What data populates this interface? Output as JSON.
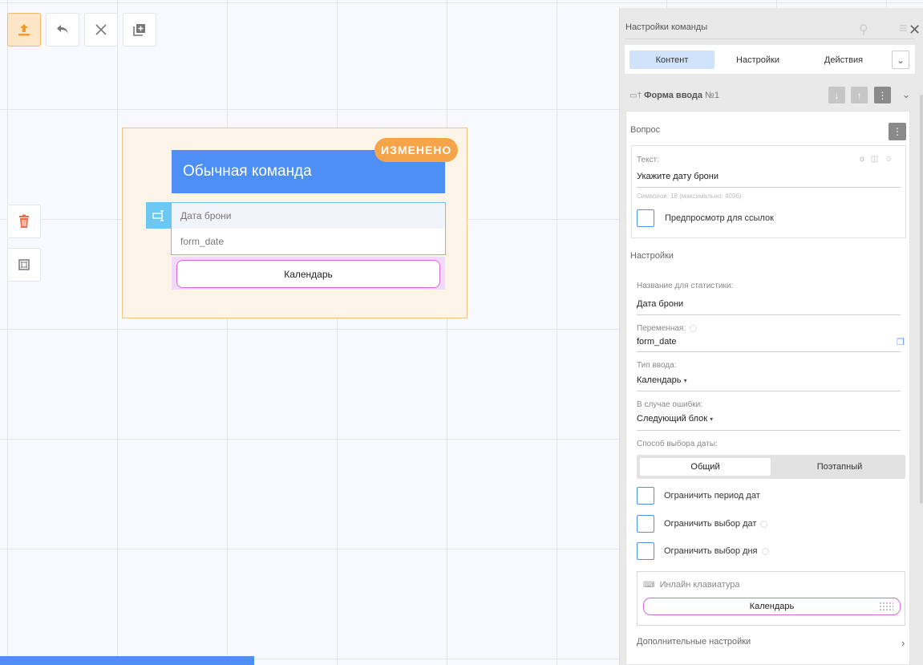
{
  "canvas": {
    "toolbar": {
      "publish_icon": "upload-icon",
      "undo_icon": "undo-icon",
      "close_icon": "close-icon",
      "add_icon": "add-block-icon"
    },
    "side_tools": {
      "delete_icon": "trash-icon",
      "frame_icon": "frame-icon"
    },
    "block": {
      "badge": "ИЗМЕНЕНО",
      "title": "Обычная команда",
      "form_label": "Дата брони",
      "form_variable": "form_date",
      "keyboard_button": "Календарь"
    }
  },
  "panel": {
    "title": "Настройки команды",
    "tabs": [
      {
        "label": "Контент",
        "selected": true
      },
      {
        "label": "Настройки",
        "selected": false
      },
      {
        "label": "Действия",
        "selected": false
      }
    ],
    "form": {
      "title": "Форма ввода",
      "number": "№1"
    },
    "question": {
      "section": "Вопрос",
      "text_label": "Текст:",
      "text_value": "Укажите дату брони",
      "chars_note": "Символов: 18 (максимально: 4096)",
      "preview_label": "Предпросмотр для ссылок"
    },
    "settings": {
      "section": "Настройки",
      "stat_name_label": "Название для статистики:",
      "stat_name_value": "Дата брони",
      "variable_label": "Переменная:",
      "variable_value": "form_date",
      "input_type_label": "Тип ввода:",
      "input_type_value": "Календарь",
      "on_error_label": "В случае ошибки:",
      "on_error_value": "Следующий блок",
      "date_method_label": "Способ выбора даты:",
      "date_method_options": [
        "Общий",
        "Поэтапный"
      ],
      "limit_period_label": "Ограничить период дат",
      "limit_dates_label": "Ограничить выбор дат",
      "limit_day_label": "Ограничить выбор дня",
      "inline_kb_label": "Инлайн клавиатура",
      "inline_kb_button": "Календарь",
      "more_settings": "Дополнительные настройки"
    }
  },
  "colors": {
    "accent": "#4d8ff5",
    "changed_badge": "#f6a44a",
    "form_border": "#67c6ee",
    "keyboard_border": "#d46ad8"
  }
}
